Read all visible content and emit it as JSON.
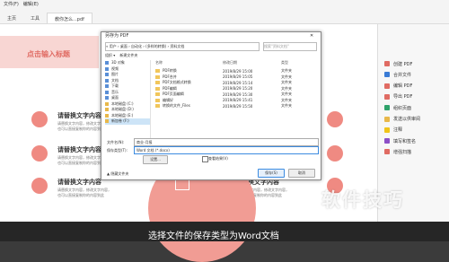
{
  "app": {
    "menu": [
      "文件(F)",
      "编辑(E)"
    ],
    "tabs": [
      "主页",
      "工具",
      "教你怎么...pdf"
    ],
    "share": "共享"
  },
  "page": {
    "section_title": "点击输入标题",
    "headline": "请替换文字内容",
    "body_lines": [
      "请替换文字内容，修改文字内容，",
      "也可以直接复制你的内容到此"
    ]
  },
  "right_panel": [
    {
      "label": "创建 PDF",
      "color": "#e06b63"
    },
    {
      "label": "合并文件",
      "color": "#3a7bd5"
    },
    {
      "label": "编辑 PDF",
      "color": "#e06b63"
    },
    {
      "label": "导出 PDF",
      "color": "#e06b63"
    },
    {
      "label": "组织页面",
      "color": "#2fa36b"
    },
    {
      "label": "发送以供审阅",
      "color": "#e8b84a"
    },
    {
      "label": "注释",
      "color": "#f0c419"
    },
    {
      "label": "填写和签名",
      "color": "#8c4fc7"
    },
    {
      "label": "增强扫描",
      "color": "#e06b63"
    }
  ],
  "dialog": {
    "title": "另存为 PDF",
    "address": "« 用户 › 桌面 › 自动化 › (多样的转换) › 资料文档",
    "search_placeholder": "搜索\"资料文档\"",
    "toolbar": [
      "组织 ▾",
      "新建文件夹"
    ],
    "nav": [
      {
        "label": "3D 对象",
        "sel": false,
        "y": false
      },
      {
        "label": "视频",
        "sel": false,
        "y": false
      },
      {
        "label": "图片",
        "sel": false,
        "y": false
      },
      {
        "label": "文档",
        "sel": false,
        "y": false
      },
      {
        "label": "下载",
        "sel": false,
        "y": false
      },
      {
        "label": "音乐",
        "sel": false,
        "y": false
      },
      {
        "label": "桌面",
        "sel": false,
        "y": false
      },
      {
        "label": "本地磁盘 (C:)",
        "sel": false,
        "y": true
      },
      {
        "label": "本地磁盘 (D:)",
        "sel": false,
        "y": true
      },
      {
        "label": "本地磁盘 (E:)",
        "sel": false,
        "y": true
      },
      {
        "label": "新加卷 (F:)",
        "sel": true,
        "y": true
      }
    ],
    "columns": [
      "名称",
      "修改日期",
      "类型"
    ],
    "files": [
      {
        "name": "PDF转换",
        "date": "2019/8/29 15:00",
        "type": "文件夹",
        "pdf": false
      },
      {
        "name": "PDF合并",
        "date": "2019/8/29 15:05",
        "type": "文件夹",
        "pdf": false
      },
      {
        "name": "PDF文档格式转换",
        "date": "2019/8/29 15:14",
        "type": "文件夹",
        "pdf": false
      },
      {
        "name": "PDF编辑",
        "date": "2019/8/29 15:20",
        "type": "文件夹",
        "pdf": false
      },
      {
        "name": "PDF页面编辑",
        "date": "2019/8/29 15:30",
        "type": "文件夹",
        "pdf": false
      },
      {
        "name": "编辑好",
        "date": "2019/8/29 15:41",
        "type": "文件夹",
        "pdf": false
      },
      {
        "name": "转换的文件_Files",
        "date": "2019/8/29 15:50",
        "type": "文件夹",
        "pdf": false
      }
    ],
    "filename_label": "文件名(N):",
    "filename_value": "商业-月报",
    "filetype_label": "保存类型(T):",
    "filetype_value": "Word 文档 (*.docx)",
    "settings_button": "设置...",
    "checkbox_label": "查看结果(V)",
    "hide_folders": "▲ 隐藏文件夹",
    "save_button": "保存(S)",
    "cancel_button": "取消"
  },
  "overlay": {
    "watermark": "软件技巧",
    "subtitle": "选择文件的保存类型为Word文档"
  },
  "colors": {
    "accent": "#e06b63",
    "brand_blue": "#1a73e8"
  }
}
